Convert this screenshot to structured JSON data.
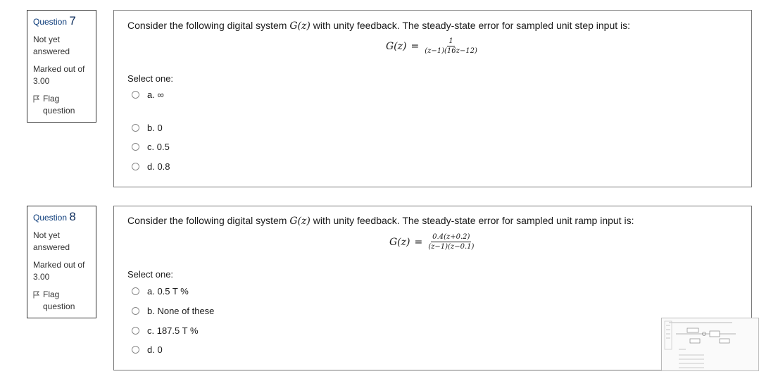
{
  "q7": {
    "label": "Question",
    "number": "7",
    "status": "Not yet answered",
    "mark": "Marked out of 3.00",
    "flag": "Flag question",
    "text_pre": "Consider the following digital system",
    "text_sym": "G(z)",
    "text_post": "with unity feedback. The steady-state error for sampled unit step input is:",
    "formula_lhs": "G(z)",
    "formula_eq": "=",
    "formula_num": "1",
    "formula_den": "(z−1)(16z−12)",
    "select_label": "Select one:",
    "options": [
      "a. ∞",
      "b. 0",
      "c. 0.5",
      "d. 0.8"
    ]
  },
  "q8": {
    "label": "Question",
    "number": "8",
    "status": "Not yet answered",
    "mark": "Marked out of 3.00",
    "flag": "Flag question",
    "text_pre": "Consider the following digital system",
    "text_sym": "G(z)",
    "text_post": "with unity feedback. The steady-state error for sampled unit ramp input is:",
    "formula_lhs": "G(z)",
    "formula_eq": "=",
    "formula_num": "0.4(z+0.2)",
    "formula_den": "(z−1)(z−0.1)",
    "select_label": "Select one:",
    "options": [
      "a. 0.5 T %",
      "b. None of these",
      "c. 187.5 T %",
      "d. 0"
    ]
  },
  "icons": {
    "flag": "flag-icon",
    "thumbnail": "diagram-thumbnail"
  }
}
